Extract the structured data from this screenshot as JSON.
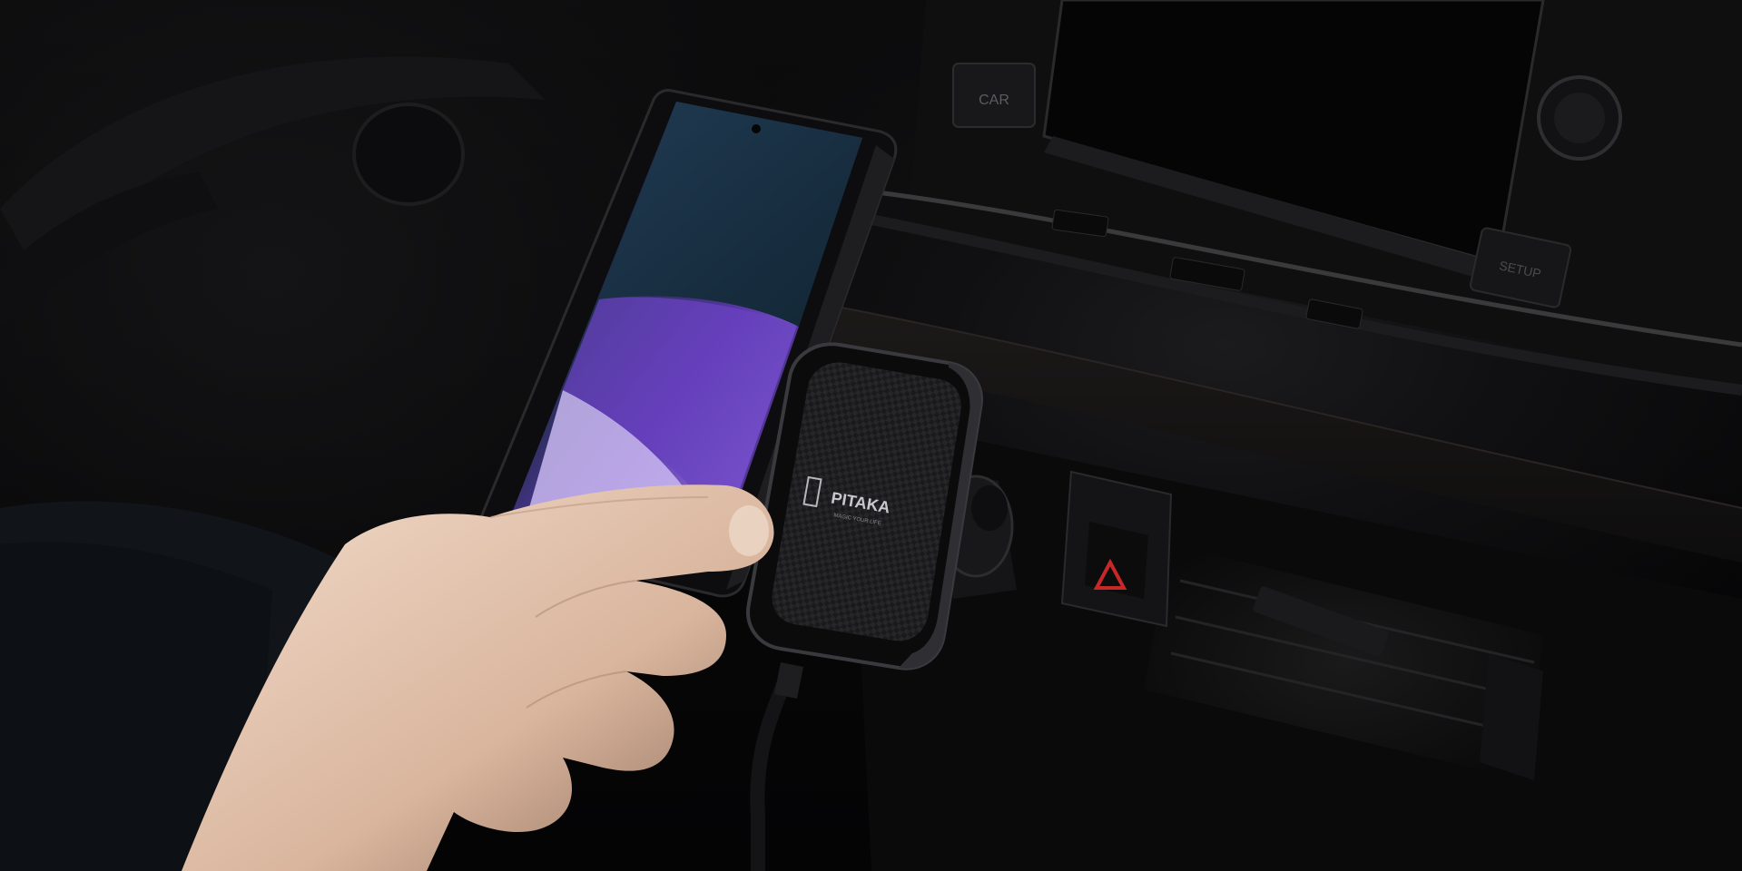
{
  "photo": {
    "dashboard_buttons": {
      "car_label": "CAR",
      "setup_label": "SETUP"
    },
    "mount": {
      "brand_text": "PITAKA",
      "brand_tagline": "MAGIC YOUR LIFE"
    },
    "colors": {
      "background": "#070708",
      "phone_screen_purple": "#7a4fd6",
      "phone_screen_lavender": "#c9b8f0",
      "phone_screen_teal": "#1c3a4a",
      "hazard_red": "#c62828",
      "skin": "#e8c9b4"
    }
  }
}
